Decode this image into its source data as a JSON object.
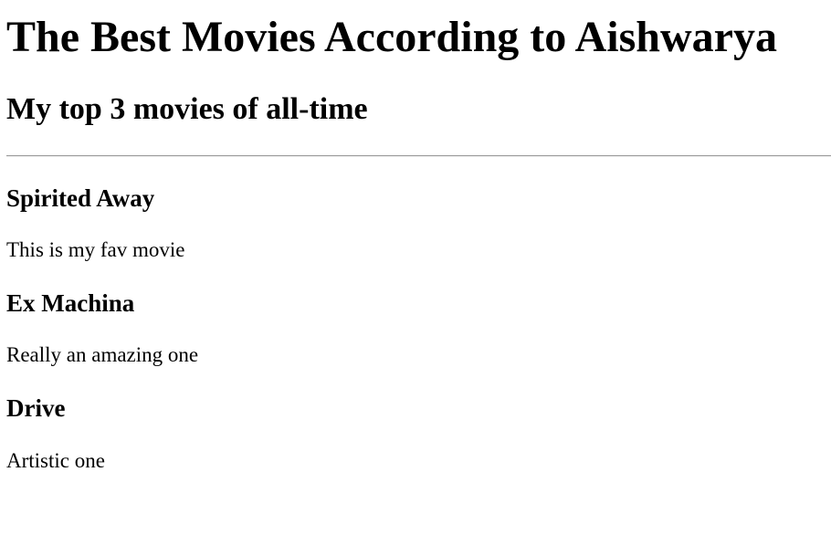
{
  "header": {
    "title": "The Best Movies According to Aishwarya",
    "subtitle": "My top 3 movies of all-time"
  },
  "movies": [
    {
      "title": "Spirited Away",
      "description": "This is my fav movie"
    },
    {
      "title": "Ex Machina",
      "description": "Really an amazing one"
    },
    {
      "title": "Drive",
      "description": "Artistic one"
    }
  ]
}
